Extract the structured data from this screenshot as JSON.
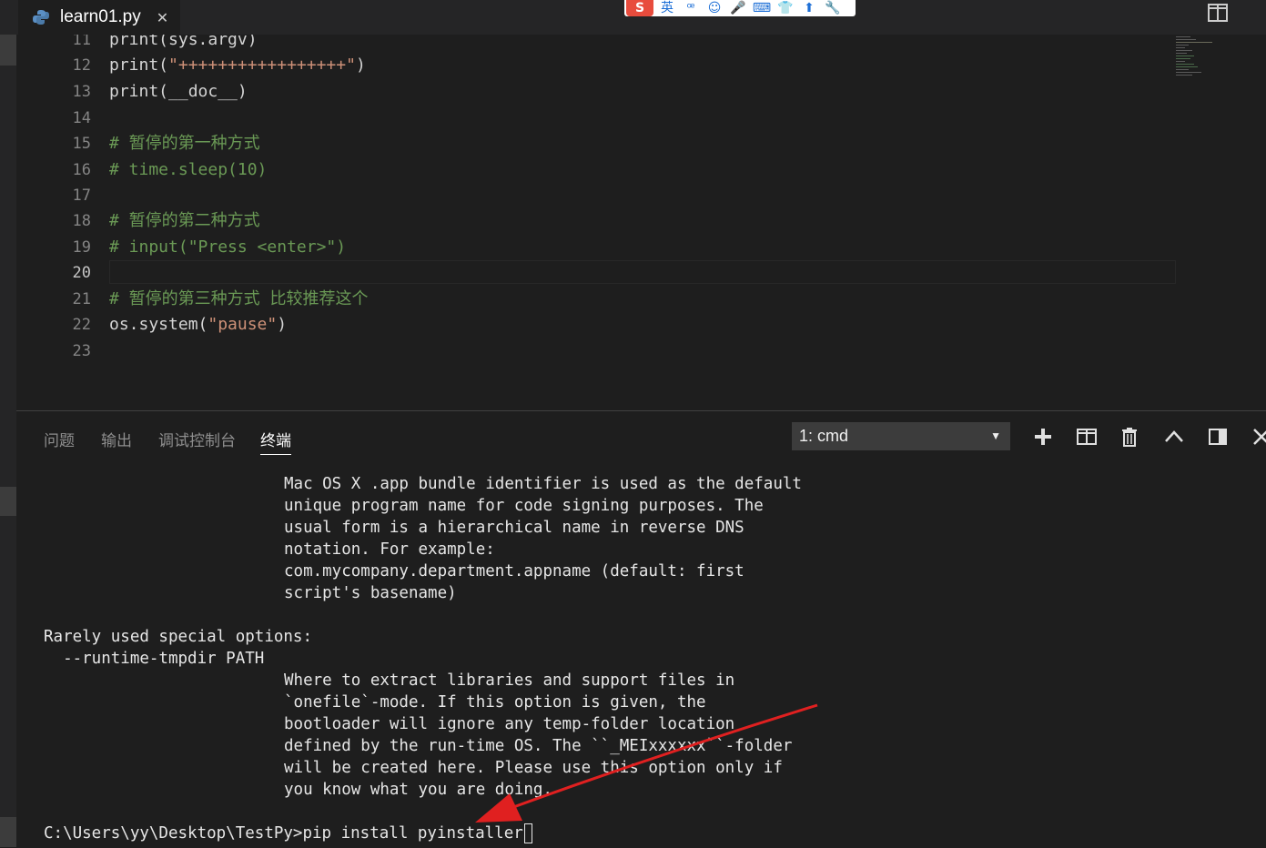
{
  "tab": {
    "filename": "learn01.py",
    "close_glyph": "✕"
  },
  "ime_toolbar": {
    "logo": "S",
    "icons": [
      "英",
      "ꟹ",
      "☺",
      "🎤",
      "⌨",
      "👕",
      "⬆",
      "🔧"
    ]
  },
  "editor": {
    "active_line": "20",
    "lines": [
      {
        "n": "11",
        "code": "print(sys.argv)"
      },
      {
        "n": "12",
        "pre": "print(",
        "str": "\"+++++++++++++++++\"",
        "post": ")"
      },
      {
        "n": "13",
        "code": "print(__doc__)"
      },
      {
        "n": "14",
        "code": ""
      },
      {
        "n": "15",
        "comment": "# 暂停的第一种方式"
      },
      {
        "n": "16",
        "comment": "# time.sleep(10)"
      },
      {
        "n": "17",
        "code": ""
      },
      {
        "n": "18",
        "comment": "# 暂停的第二种方式"
      },
      {
        "n": "19",
        "comment": "# input(\"Press <enter>\")"
      },
      {
        "n": "20",
        "code": ""
      },
      {
        "n": "21",
        "comment": "# 暂停的第三种方式 比较推荐这个"
      },
      {
        "n": "22",
        "pre": "os.system(",
        "str": "\"pause\"",
        "post": ")"
      },
      {
        "n": "23",
        "code": ""
      }
    ]
  },
  "panel": {
    "tabs": [
      "问题",
      "输出",
      "调试控制台",
      "终端"
    ],
    "active_tab": "终端",
    "terminal_select": "1: cmd",
    "terminal_lines": [
      {
        "indent": true,
        "text": "Mac OS X .app bundle identifier is used as the default"
      },
      {
        "indent": true,
        "text": "unique program name for code signing purposes. The"
      },
      {
        "indent": true,
        "text": "usual form is a hierarchical name in reverse DNS"
      },
      {
        "indent": true,
        "text": "notation. For example:"
      },
      {
        "indent": true,
        "text": "com.mycompany.department.appname (default: first"
      },
      {
        "indent": true,
        "text": "script's basename)"
      },
      {
        "indent": false,
        "text": ""
      },
      {
        "indent": false,
        "text": "Rarely used special options:"
      },
      {
        "indent": false,
        "text": "  --runtime-tmpdir PATH"
      },
      {
        "indent": true,
        "text": "Where to extract libraries and support files in"
      },
      {
        "indent": true,
        "text": "`onefile`-mode. If this option is given, the"
      },
      {
        "indent": true,
        "text": "bootloader will ignore any temp-folder location"
      },
      {
        "indent": true,
        "text": "defined by the run-time OS. The ``_MEIxxxxxx``-folder"
      },
      {
        "indent": true,
        "text": "will be created here. Please use this option only if"
      },
      {
        "indent": true,
        "text": "you know what you are doing."
      }
    ],
    "prompt": "C:\\Users\\yy\\Desktop\\TestPy>pip install pyinstaller"
  },
  "colors": {
    "annotation_arrow": "#e02020",
    "comment": "#6a9955",
    "string": "#ce9178"
  }
}
